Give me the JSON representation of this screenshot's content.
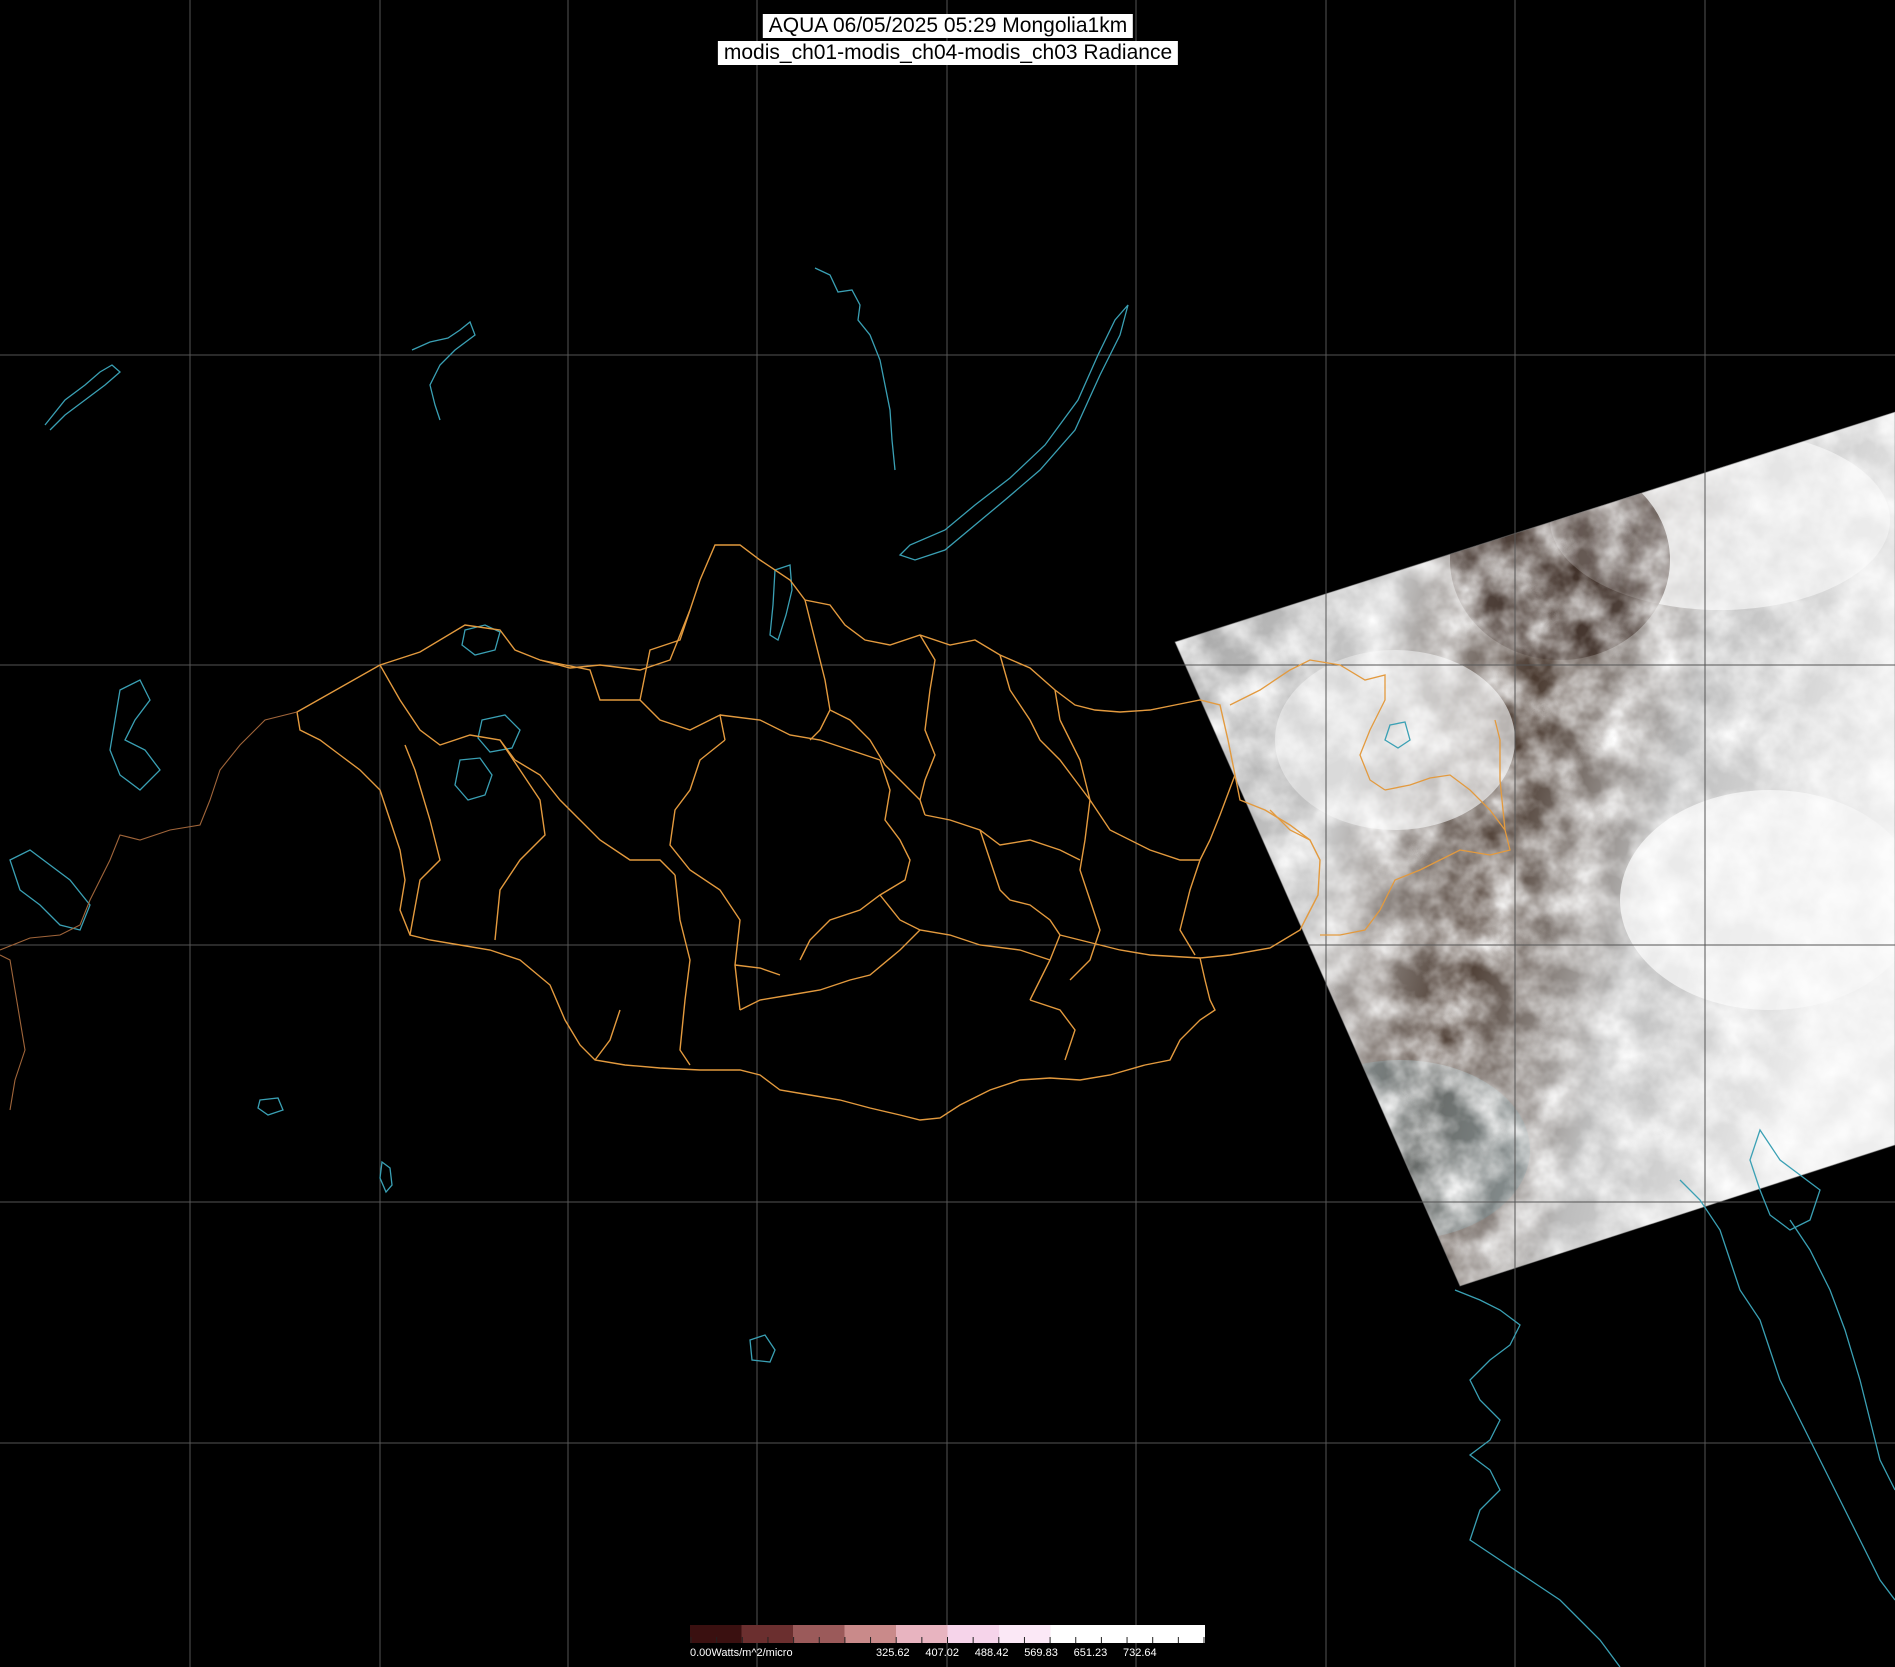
{
  "title": {
    "line1": "AQUA 06/05/2025 05:29 Mongolia1km",
    "line2": "modis_ch01-modis_ch04-modis_ch03 Radiance"
  },
  "colorbar": {
    "unit_label": "0.00Watts/m^2/micro",
    "ticks": [
      "325.62",
      "407.02",
      "488.42",
      "569.83",
      "651.23",
      "732.64"
    ],
    "colors": [
      "#3a1010",
      "#6b2f2f",
      "#9b5a5a",
      "#c98a8a",
      "#e8b4c0",
      "#f6d4ea",
      "#fbe8f6",
      "#ffffff",
      "#ffffff",
      "#ffffff"
    ]
  },
  "map": {
    "background": "#000000",
    "graticule_color": "#555555",
    "border_color": "#e39a3e",
    "coast_color": "#3aa0b4",
    "swath_colors": [
      "#8a8a8a",
      "#d8d8d8",
      "#3a2a22",
      "#a7a7a7",
      "#f2f2f2"
    ]
  }
}
